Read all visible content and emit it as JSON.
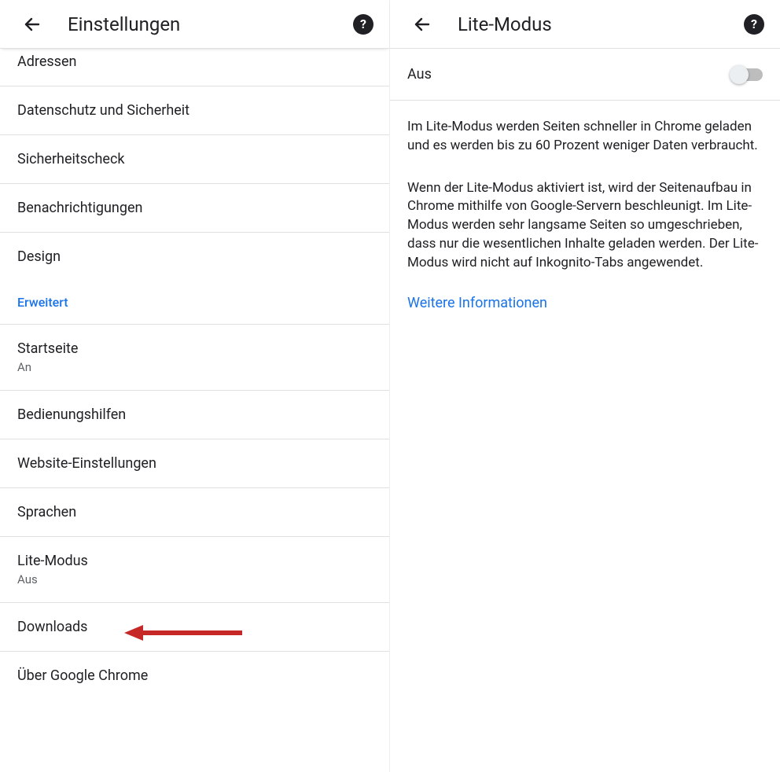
{
  "left": {
    "title": "Einstellungen",
    "items": {
      "addresses": "Adressen",
      "privacy": "Datenschutz und Sicherheit",
      "safety": "Sicherheitscheck",
      "notifications": "Benachrichtigungen",
      "design": "Design",
      "advanced": "Erweitert",
      "homepage": {
        "label": "Startseite",
        "value": "An"
      },
      "accessibility": "Bedienungshilfen",
      "siteSettings": "Website-Einstellungen",
      "languages": "Sprachen",
      "liteMode": {
        "label": "Lite-Modus",
        "value": "Aus"
      },
      "downloads": "Downloads",
      "about": "Über Google Chrome"
    }
  },
  "right": {
    "title": "Lite-Modus",
    "toggleLabel": "Aus",
    "para1": "Im Lite-Modus werden Seiten schneller in Chrome geladen und es werden bis zu 60 Prozent weniger Daten verbraucht.",
    "para2": "Wenn der Lite-Modus aktiviert ist, wird der Seitenaufbau in Chrome mithilfe von Google-Servern beschleunigt. Im Lite-Modus werden sehr langsame Seiten so umgeschrieben, dass nur die wesentlichen Inhalte geladen werden. Der Lite-Modus wird nicht auf Inkognito-Tabs angewendet.",
    "moreInfo": "Weitere Informationen"
  },
  "helpGlyph": "?"
}
